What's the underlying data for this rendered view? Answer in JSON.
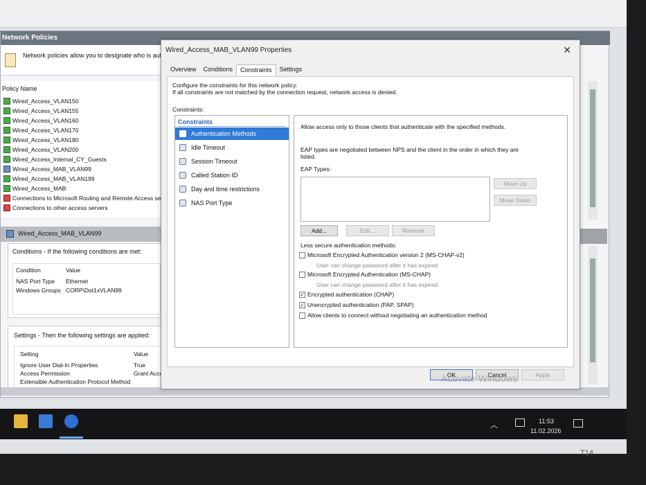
{
  "mmc": {
    "title": "Network Policies",
    "description": "Network policies allow you to designate who is autho",
    "column_policy_name": "Policy Name",
    "policies": [
      {
        "name": "Wired_Access_VLAN150",
        "icon": "policy-green-icon"
      },
      {
        "name": "Wired_Access_VLAN155",
        "icon": "policy-green-icon"
      },
      {
        "name": "Wired_Access_VLAN160",
        "icon": "policy-green-icon"
      },
      {
        "name": "Wired_Access_VLAN170",
        "icon": "policy-green-icon"
      },
      {
        "name": "Wired_Access_VLAN180",
        "icon": "policy-green-icon"
      },
      {
        "name": "Wired_Access_VLAN200",
        "icon": "policy-green-icon"
      },
      {
        "name": "Wired_Access_Internal_CY_Guests",
        "icon": "policy-green-icon"
      },
      {
        "name": "Wired_Access_MAB_VLAN99",
        "icon": "policy-blue-icon"
      },
      {
        "name": "Wired_Access_MAB_VLAN199",
        "icon": "policy-green-icon"
      },
      {
        "name": "Wired_Access_MAB",
        "icon": "policy-green-icon"
      },
      {
        "name": "Connections to Microsoft Routing and Remote Access serv",
        "icon": "policy-deny-icon"
      },
      {
        "name": "Connections to other access servers",
        "icon": "policy-deny-icon"
      }
    ],
    "selected_policy": "Wired_Access_MAB_VLAN99",
    "conditions": {
      "header": "Conditions - If the following conditions are met:",
      "col_condition": "Condition",
      "col_value": "Value",
      "rows": [
        {
          "condition": "NAS Port Type",
          "value": "Ethernet"
        },
        {
          "condition": "Windows Groups",
          "value": "CORP\\Dot1xVLAN99"
        }
      ]
    },
    "settings": {
      "header": "Settings - Then the following settings are applied:",
      "col_setting": "Setting",
      "col_value": "Value",
      "rows": [
        {
          "setting": "Ignore User Dial-In Properties",
          "value": "True"
        },
        {
          "setting": "Access Permission",
          "value": "Grant Access"
        },
        {
          "setting": "Extensible Authentication Protocol Method",
          "value": ""
        }
      ]
    }
  },
  "dialog": {
    "title": "Wired_Access_MAB_VLAN99 Properties",
    "tabs": [
      "Overview",
      "Conditions",
      "Constraints",
      "Settings"
    ],
    "active_tab": "Constraints",
    "intro_line1": "Configure the constraints for this network policy.",
    "intro_line2": "If all constraints are not matched by the connection request, network access is denied.",
    "constraints_label": "Constraints:",
    "constraints_header": "Constraints",
    "constraints": [
      {
        "label": "Authentication Methods",
        "selected": true
      },
      {
        "label": "Idle Timeout",
        "selected": false
      },
      {
        "label": "Session Timeout",
        "selected": false
      },
      {
        "label": "Called Station ID",
        "selected": false
      },
      {
        "label": "Day and time restrictions",
        "selected": false
      },
      {
        "label": "NAS Port Type",
        "selected": false
      }
    ],
    "right": {
      "allow_text": "Allow access only to those clients that authenticate with the specified methods.",
      "eap_order_line1": "EAP types are negotiated between NPS and the client in the order in which they are",
      "eap_order_line2": "listed.",
      "eap_types_label": "EAP Types:",
      "move_up": "Move Up",
      "move_down": "Move Down",
      "add": "Add...",
      "edit": "Edit...",
      "remove": "Remove",
      "less_secure_label": "Less secure authentication methods:",
      "methods": [
        {
          "label": "Microsoft Encrypted Authentication version 2 (MS-CHAP-v2)",
          "checked": false
        },
        {
          "label": "User can change password after it has expired",
          "checked": false,
          "sub": true
        },
        {
          "label": "Microsoft Encrypted Authentication (MS-CHAP)",
          "checked": false
        },
        {
          "label": "User can change password after it has expired",
          "checked": false,
          "sub": true
        },
        {
          "label": "Encrypted authentication (CHAP)",
          "checked": true
        },
        {
          "label": "Unencrypted authentication (PAP, SPAP)",
          "checked": true
        },
        {
          "label": "Allow clients to connect without negotiating an authentication method",
          "checked": false
        }
      ]
    },
    "ok": "OK",
    "cancel": "Cancel",
    "apply": "Apply",
    "watermark": "Activate Windows"
  },
  "taskbar": {
    "time": "11:53",
    "date": "11.02.2026"
  },
  "bezel_label": "T14"
}
